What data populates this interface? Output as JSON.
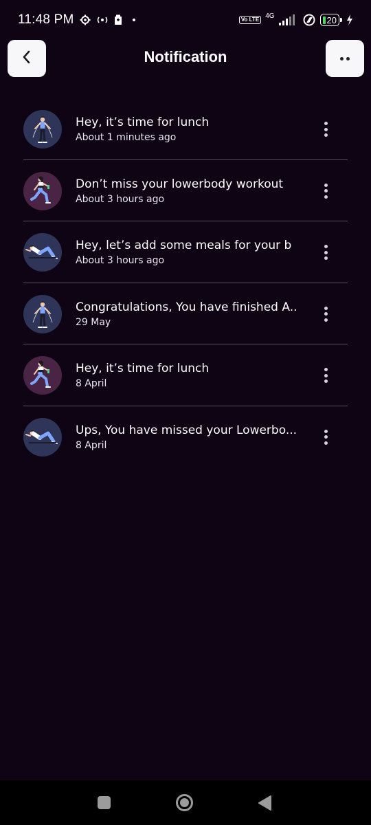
{
  "status_bar": {
    "time": "11:48 PM",
    "volte": "Vo LTE",
    "network": "4G",
    "battery": "20",
    "icons": [
      "gear-icon",
      "radio-icon",
      "sim-icon",
      "dot-icon",
      "signal-icon",
      "sync-icon",
      "battery-icon",
      "charging-icon"
    ]
  },
  "header": {
    "title": "Notification",
    "back_icon": "chevron-left-icon",
    "more_icon": "more-horizontal-icon"
  },
  "notifications": [
    {
      "title": "Hey, it’s time for lunch",
      "time": "About 1 minutes ago",
      "avatar": "jump-rope-figure",
      "avatar_bg": "#2e3559"
    },
    {
      "title": "Don’t miss your lowerbody workout",
      "time": "About 3 hours ago",
      "avatar": "lunge-figure",
      "avatar_bg": "#4a2445"
    },
    {
      "title": "Hey, let’s add some meals for your b",
      "time": "About 3 hours ago",
      "avatar": "situp-figure",
      "avatar_bg": "#2e3559"
    },
    {
      "title": "Congratulations, You have finished A..",
      "time": "29 May",
      "avatar": "jump-rope-figure",
      "avatar_bg": "#2e3559"
    },
    {
      "title": "Hey, it’s time for lunch",
      "time": "8 April",
      "avatar": "lunge-figure",
      "avatar_bg": "#4a2445"
    },
    {
      "title": "Ups, You have missed your Lowerbo...",
      "time": "8 April",
      "avatar": "situp-figure",
      "avatar_bg": "#2e3559"
    }
  ],
  "colors": {
    "background": "#0f0414",
    "button_bg": "#f7f7f9",
    "divider": "#5a5560"
  }
}
